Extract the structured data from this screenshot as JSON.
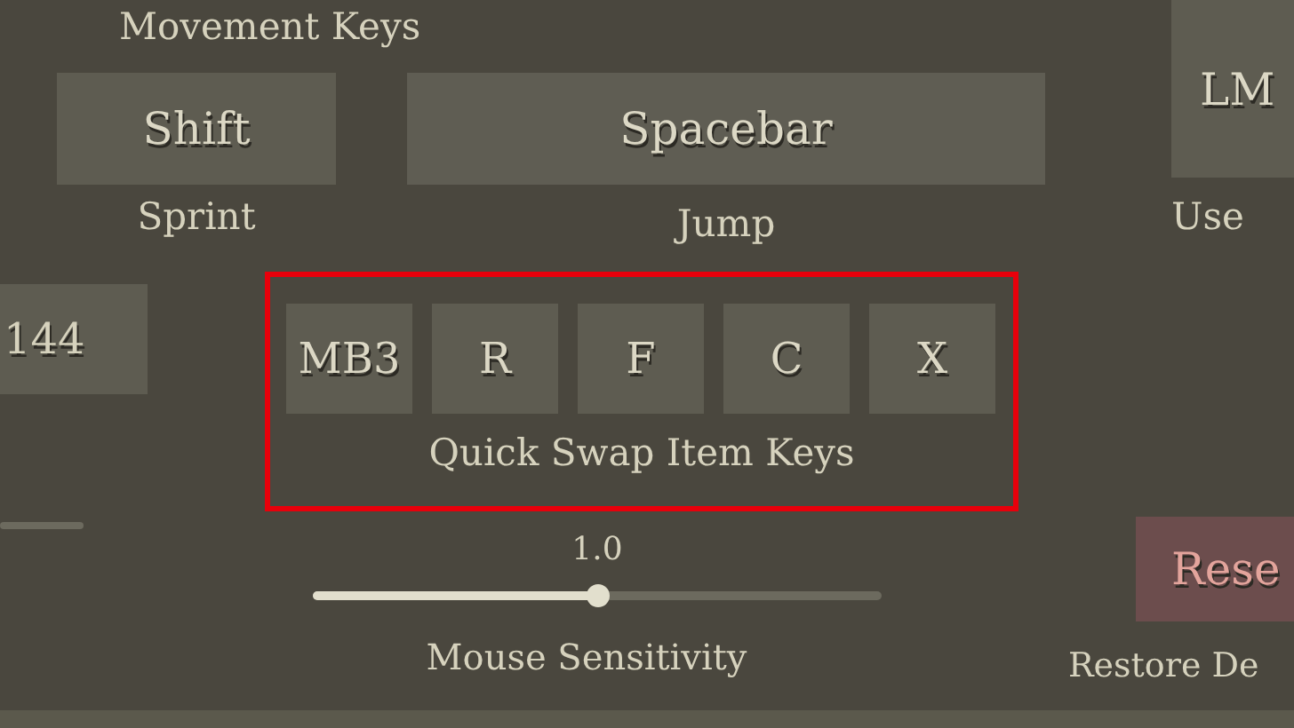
{
  "movement": {
    "title": "Movement Keys",
    "bindings": [
      {
        "key": "Shift",
        "action": "Sprint"
      },
      {
        "key": "Spacebar",
        "action": "Jump"
      }
    ]
  },
  "use_item": {
    "key": "LM",
    "action": "Use"
  },
  "left_field": {
    "value": "144"
  },
  "quick_swap": {
    "highlighted": true,
    "keys": [
      "MB3",
      "R",
      "F",
      "C",
      "X"
    ],
    "label": "Quick Swap Item Keys"
  },
  "mouse_sensitivity": {
    "reading": "1.0",
    "level": 0.5,
    "label": "Mouse Sensitivity"
  },
  "reset": {
    "button": "Rese",
    "label": "Restore De"
  }
}
